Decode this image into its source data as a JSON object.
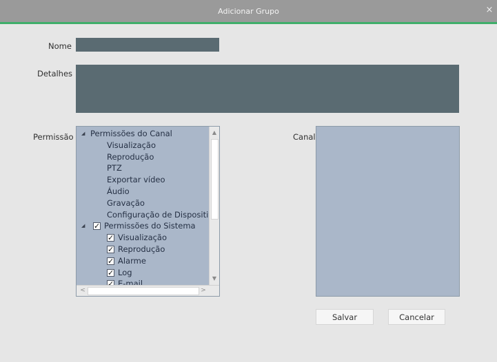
{
  "dialog": {
    "title": "Adicionar Grupo",
    "close_glyph": "×",
    "accent_color": "#3fae6a"
  },
  "form": {
    "nome_label": "Nome",
    "nome_value": "",
    "detalhes_label": "Detalhes",
    "detalhes_value": "",
    "permissao_label": "Permissão",
    "canal_label": "Canal"
  },
  "permissions_tree": [
    {
      "label": "Permissões do Canal",
      "level": 0,
      "expander": "◢",
      "checkbox": false,
      "checked": false
    },
    {
      "label": "Visualização",
      "level": 1,
      "checkbox": false,
      "checked": false
    },
    {
      "label": "Reprodução",
      "level": 1,
      "checkbox": false,
      "checked": false
    },
    {
      "label": "PTZ",
      "level": 1,
      "checkbox": false,
      "checked": false
    },
    {
      "label": "Exportar vídeo",
      "level": 1,
      "checkbox": false,
      "checked": false
    },
    {
      "label": "Áudio",
      "level": 1,
      "checkbox": false,
      "checked": false
    },
    {
      "label": "Gravação",
      "level": 1,
      "checkbox": false,
      "checked": false
    },
    {
      "label": "Configuração de Dispositivo",
      "level": 1,
      "checkbox": false,
      "checked": false
    },
    {
      "label": "Permissões do Sistema",
      "level": 0,
      "expander": "◢",
      "checkbox": true,
      "checked": true
    },
    {
      "label": "Visualização",
      "level": 1,
      "checkbox": true,
      "checked": true
    },
    {
      "label": "Reprodução",
      "level": 1,
      "checkbox": true,
      "checked": true
    },
    {
      "label": "Alarme",
      "level": 1,
      "checkbox": true,
      "checked": true
    },
    {
      "label": "Log",
      "level": 1,
      "checkbox": true,
      "checked": true
    },
    {
      "label": "E-mail",
      "level": 1,
      "checkbox": true,
      "checked": true
    }
  ],
  "buttons": {
    "save": "Salvar",
    "cancel": "Cancelar"
  },
  "icons": {
    "check": "✓",
    "scroll_up": "▲",
    "scroll_down": "▼",
    "scroll_left": "<",
    "scroll_right": ">"
  }
}
